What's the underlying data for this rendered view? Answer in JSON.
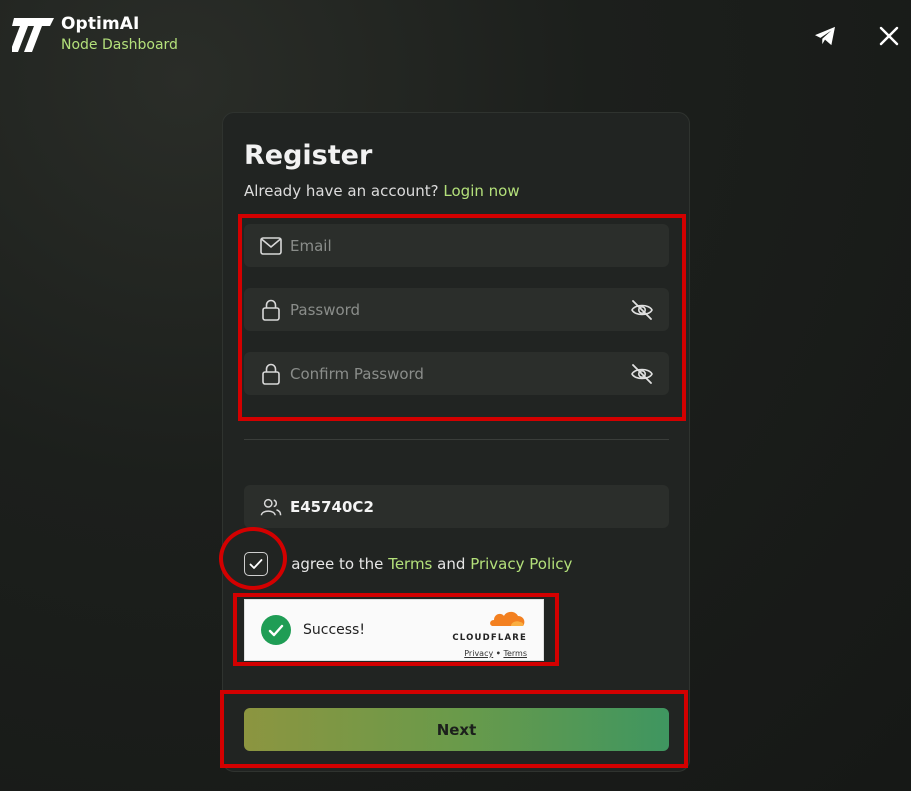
{
  "header": {
    "brand_name": "OptimAI",
    "brand_sub": "Node Dashboard",
    "icons": [
      "telegram-icon",
      "x-icon"
    ]
  },
  "register": {
    "title": "Register",
    "already_text": "Already have an account?",
    "login_link": "Login now",
    "email_placeholder": "Email",
    "password_placeholder": "Password",
    "confirm_placeholder": "Confirm Password",
    "referral_code": "E45740C2",
    "agree_prefix": "I agree to the",
    "terms": "Terms",
    "and": "and",
    "privacy": "Privacy Policy",
    "agreed": true,
    "next_label": "Next"
  },
  "captcha": {
    "status": "Success!",
    "brand": "CLOUDFLARE",
    "privacy": "Privacy",
    "separator": "•",
    "terms": "Terms"
  },
  "colors": {
    "accent": "#b3e07a",
    "annotation": "#d30000",
    "success": "#1f9d55"
  }
}
